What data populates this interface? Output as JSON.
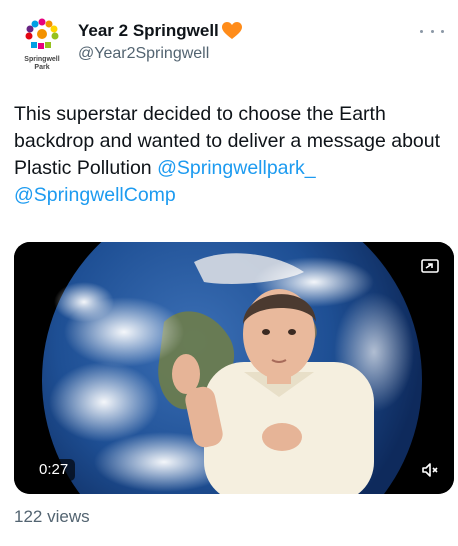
{
  "account": {
    "display_name": "Year 2 Springwell",
    "handle": "@Year2Springwell",
    "avatar_line1": "Springwell",
    "avatar_line2": "Park",
    "heart_color": "#ff8c1a"
  },
  "tweet": {
    "text": "This superstar decided to choose the Earth backdrop and wanted to deliver a message about Plastic Pollution ",
    "mention1": "@Springwellpark_",
    "mention2": "@SpringwellComp"
  },
  "video": {
    "duration": "0:27",
    "mute_icon": "speaker-muted-icon",
    "pip_icon": "picture-in-picture-icon"
  },
  "stats": {
    "views": "122 views"
  }
}
